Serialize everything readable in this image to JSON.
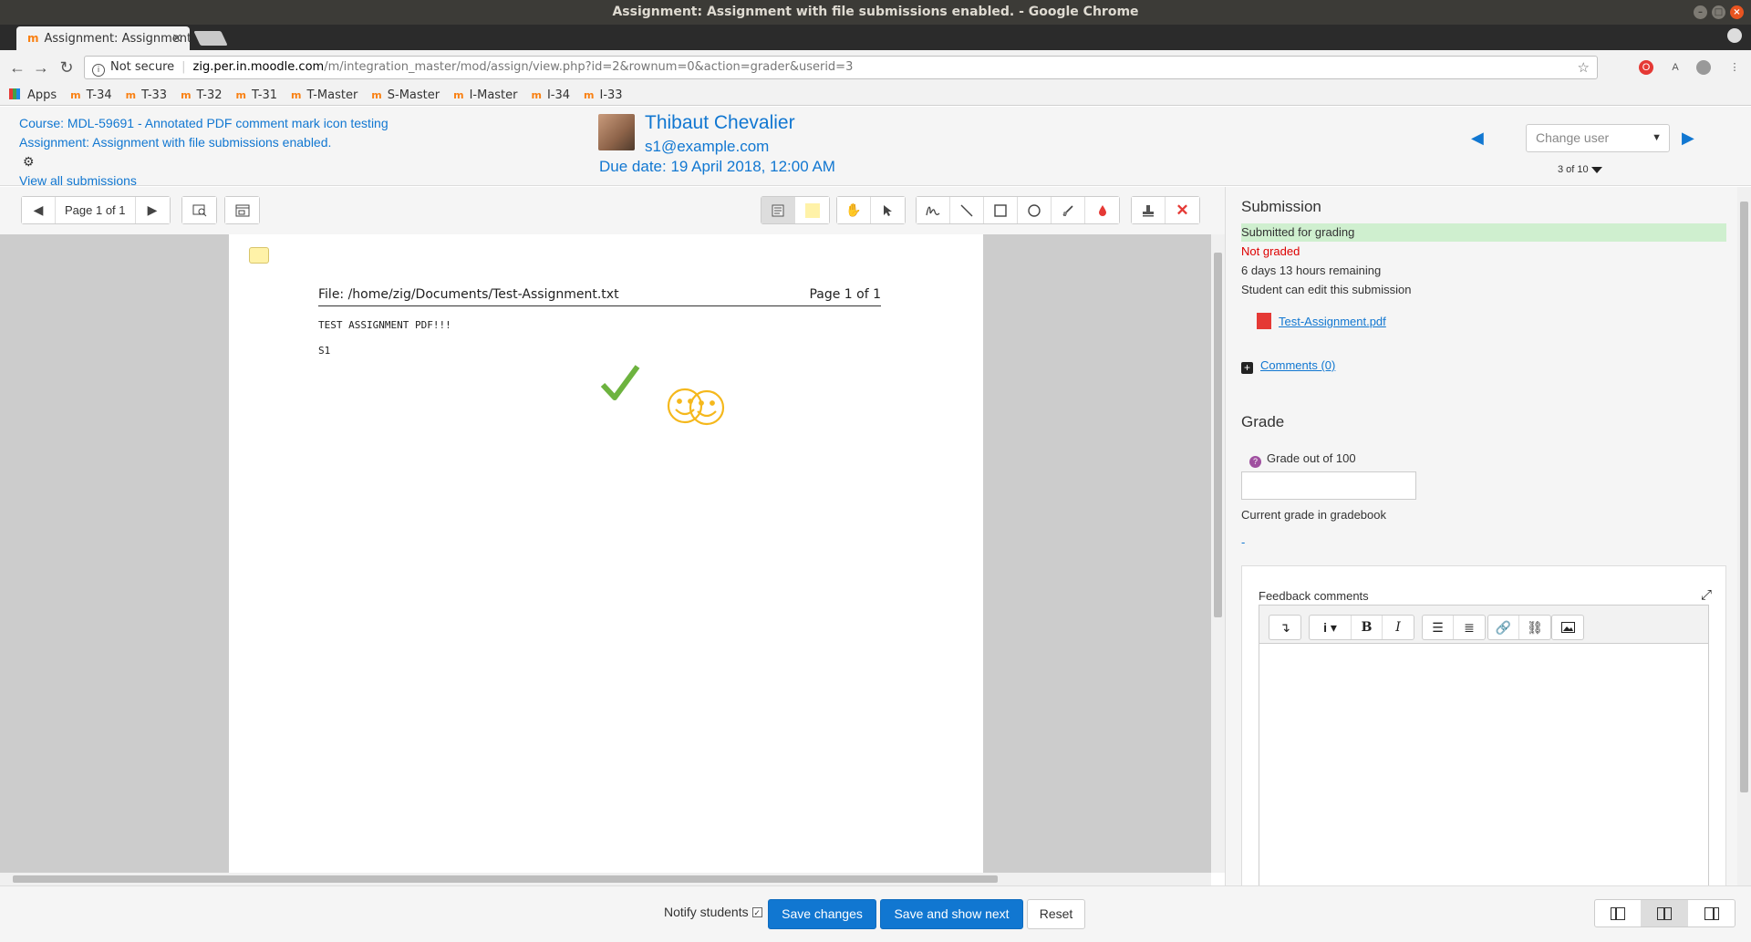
{
  "window": {
    "title": "Assignment: Assignment with file submissions enabled. - Google Chrome",
    "tab_title": "Assignment: Assignment with file submissions enabled.",
    "minimize": "–",
    "maximize": "□",
    "close": "×"
  },
  "address_bar": {
    "security_label": "Not secure",
    "host": "zig.per.in.moodle.com",
    "path": "/m/integration_master/mod/assign/view.php?id=2&rownum=0&action=grader&userid=3"
  },
  "bookmarks": [
    "Apps",
    "T-34",
    "T-33",
    "T-32",
    "T-31",
    "T-Master",
    "S-Master",
    "I-Master",
    "I-34",
    "I-33"
  ],
  "header": {
    "course_link": "Course: MDL-59691 - Annotated PDF comment mark icon testing",
    "assignment_link": "Assignment: Assignment with file submissions enabled.",
    "view_all_link": "View all submissions",
    "user_name": "Thibaut Chevalier",
    "user_email": "s1@example.com",
    "due_date": "Due date: 19 April 2018, 12:00 AM",
    "change_user_placeholder": "Change user",
    "user_count": "3 of 10"
  },
  "editor_toolbar": {
    "page_label": "Page 1 of 1",
    "icons": [
      "previous-page-icon",
      "next-page-icon",
      "search-comments-icon",
      "expand-comments-icon",
      "comment-icon",
      "comment-colour-icon",
      "pan-icon",
      "select-icon",
      "pen-icon",
      "line-icon",
      "rectangle-icon",
      "oval-icon",
      "highlight-icon",
      "annotation-colour-icon",
      "stamp-icon",
      "delete-icon"
    ]
  },
  "pdf": {
    "file_header": "File: /home/zig/Documents/Test-Assignment.txt",
    "page_header": "Page 1 of 1",
    "lines": [
      "TEST ASSIGNMENT PDF!!!",
      "S1"
    ],
    "stamps": [
      "tick-stamp",
      "smiley-stamp",
      "smiley-stamp"
    ],
    "colors": {
      "tick": "#6db33f",
      "smiley": "#f5b81c",
      "comment": "#fff2a8"
    }
  },
  "submission": {
    "heading": "Submission",
    "status": "Submitted for grading",
    "grading_status": "Not graded",
    "time_remaining": "6 days 13 hours remaining",
    "edit_status": "Student can edit this submission",
    "file_name": "Test-Assignment.pdf",
    "comments_link": "Comments (0)"
  },
  "grade": {
    "heading": "Grade",
    "label": "Grade out of 100",
    "value": "",
    "current_label": "Current grade in gradebook",
    "current_value": "-",
    "feedback_label": "Feedback comments",
    "atto_icons": [
      "collapse-icon",
      "paragraph-styles-icon",
      "bold-icon",
      "italic-icon",
      "unordered-list-icon",
      "ordered-list-icon",
      "link-icon",
      "unlink-icon",
      "image-icon"
    ]
  },
  "footer": {
    "notify_label": "Notify students",
    "notify_checked": true,
    "save_label": "Save changes",
    "save_next_label": "Save and show next",
    "reset_label": "Reset"
  },
  "colors": {
    "link": "#1177d1",
    "primary_button": "#1177d1",
    "submitted_bg": "#cfefcf",
    "not_graded": "#dd0000",
    "moodle_orange": "#f98012"
  }
}
